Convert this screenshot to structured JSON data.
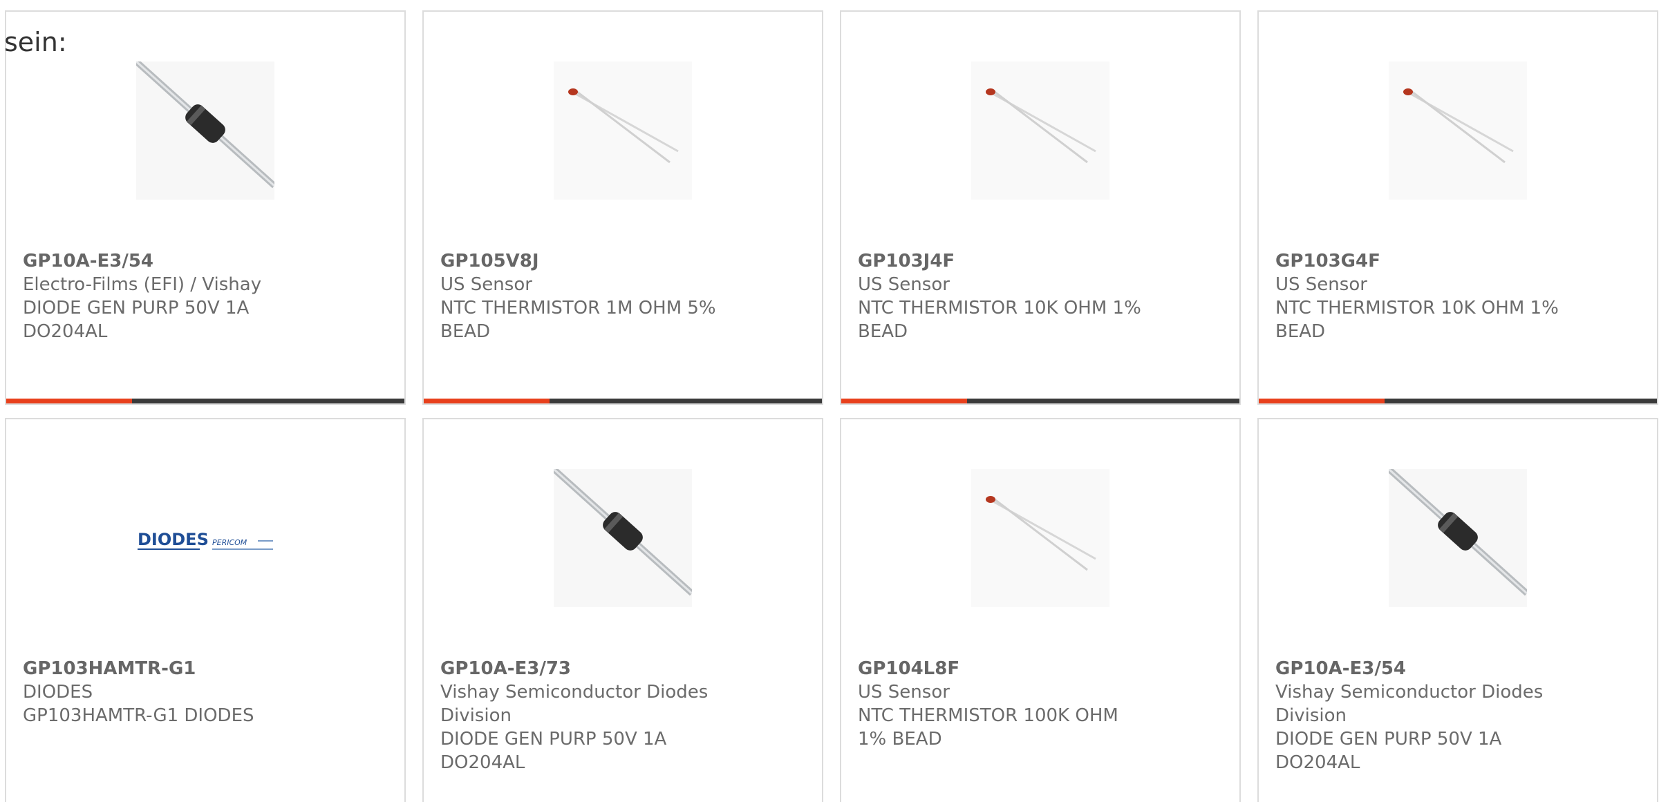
{
  "intro": {
    "text": "sein:"
  },
  "colors": {
    "accent": "#e8401c",
    "bar": "#3a3a3a",
    "text": "#6b6b6b",
    "border": "#dcdcdc"
  },
  "products": [
    {
      "part": "GP10A-E3/54",
      "manufacturer": "Electro-Films (EFI) / Vishay",
      "description": "DIODE GEN PURP 50V 1A DO204AL",
      "image": "diode-icon"
    },
    {
      "part": "GP105V8J",
      "manufacturer": "US Sensor",
      "description": "NTC THERMISTOR 1M OHM 5% BEAD",
      "image": "thermistor-icon"
    },
    {
      "part": "GP103J4F",
      "manufacturer": "US Sensor",
      "description": "NTC THERMISTOR 10K OHM 1% BEAD",
      "image": "thermistor-icon"
    },
    {
      "part": "GP103G4F",
      "manufacturer": "US Sensor",
      "description": "NTC THERMISTOR 10K OHM 1% BEAD",
      "image": "thermistor-icon"
    },
    {
      "part": "GP103HAMTR-G1",
      "manufacturer": "DIODES",
      "description": "GP103HAMTR-G1 DIODES",
      "image": "diodes-pericom-logo",
      "logo_text": [
        "DIODES",
        "PERICOM"
      ]
    },
    {
      "part": "GP10A-E3/73",
      "manufacturer": "Vishay Semiconductor Diodes Division",
      "description": "DIODE GEN PURP 50V 1A DO204AL",
      "image": "diode-icon"
    },
    {
      "part": "GP104L8F",
      "manufacturer": "US Sensor",
      "description": "NTC THERMISTOR 100K OHM 1% BEAD",
      "image": "thermistor-icon"
    },
    {
      "part": "GP10A-E3/54",
      "manufacturer": "Vishay Semiconductor Diodes Division",
      "description": "DIODE GEN PURP 50V 1A DO204AL",
      "image": "diode-icon"
    }
  ]
}
